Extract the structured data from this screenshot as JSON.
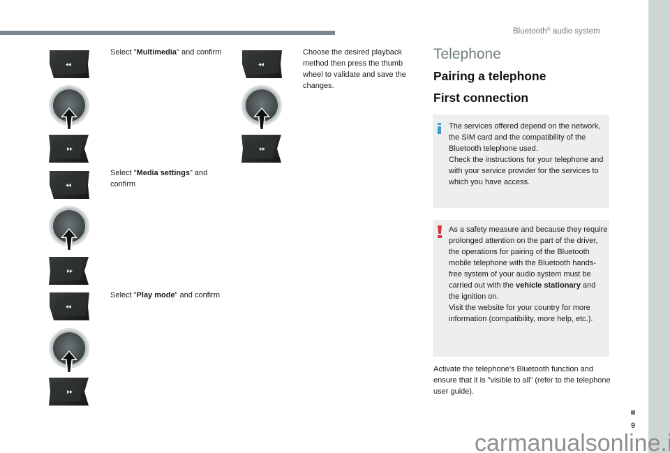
{
  "header": {
    "section_title_pre": "Bluetooth",
    "section_title_reg": "®",
    "section_title_post": " audio system"
  },
  "steps_left": [
    {
      "pre": "Select \"",
      "bold": "Multimedia",
      "post": "\" and confirm"
    },
    {
      "pre": "Select \"",
      "bold": "Media settings",
      "post": "\" and confirm"
    },
    {
      "pre": "Select \"",
      "bold": "Play mode",
      "post": "\" and confirm"
    }
  ],
  "steps_middle": [
    {
      "text": "Choose the desired playback method then press the thumb wheel to validate and save the changes."
    }
  ],
  "controls": {
    "prev_icon": "rewind-icon",
    "next_icon": "fast-forward-icon",
    "wheel_icon": "thumb-wheel-press-icon"
  },
  "telephone": {
    "heading": "Telephone",
    "subheading": "Pairing a telephone",
    "subsubheading": "First connection",
    "info_note": {
      "icon": "info-icon",
      "text_1": "The services offered depend on the network, the SIM card and the compatibility of the Bluetooth telephone used.",
      "text_2": "Check the instructions for your telephone and with your service provider for the services to which you have access."
    },
    "warning_note": {
      "icon": "warning-icon",
      "text_pre": "As a safety measure and because they require prolonged attention on the part of the driver, the operations for pairing of the Bluetooth mobile telephone with the Bluetooth hands-free system of your audio system must be carried out with the ",
      "text_bold": "vehicle stationary",
      "text_post": " and the ignition on.",
      "text_2": "Visit the website for your country for more information (compatibility, more help, etc.)."
    },
    "paragraph": "Activate the telephone's Bluetooth function and ensure that it is \"visible to all\" (refer to the telephone user guide)."
  },
  "footer": {
    "page_number": "9",
    "watermark": "carmanualsonline.info"
  },
  "colors": {
    "header_bar": "#7a8790",
    "right_strip": "#cfd6d6",
    "heading_gray": "#6f7f80",
    "note_bg": "#edefef",
    "info_blue": "#2ea3d9",
    "warning_red": "#e0303e"
  }
}
